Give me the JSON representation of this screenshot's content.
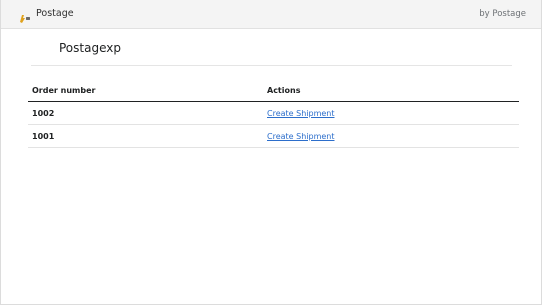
{
  "header": {
    "app_name": "Postage",
    "by_line": "by Postage",
    "logo_icon": "postage-logo-icon"
  },
  "page": {
    "title": "Postagexp"
  },
  "table": {
    "columns": [
      "Order number",
      "Actions"
    ],
    "rows": [
      {
        "order_number": "1002",
        "action_label": "Create Shipment"
      },
      {
        "order_number": "1001",
        "action_label": "Create Shipment"
      }
    ]
  },
  "colors": {
    "link": "#2c6ecb",
    "topbar": "#f4f4f4",
    "text": "#202223"
  }
}
